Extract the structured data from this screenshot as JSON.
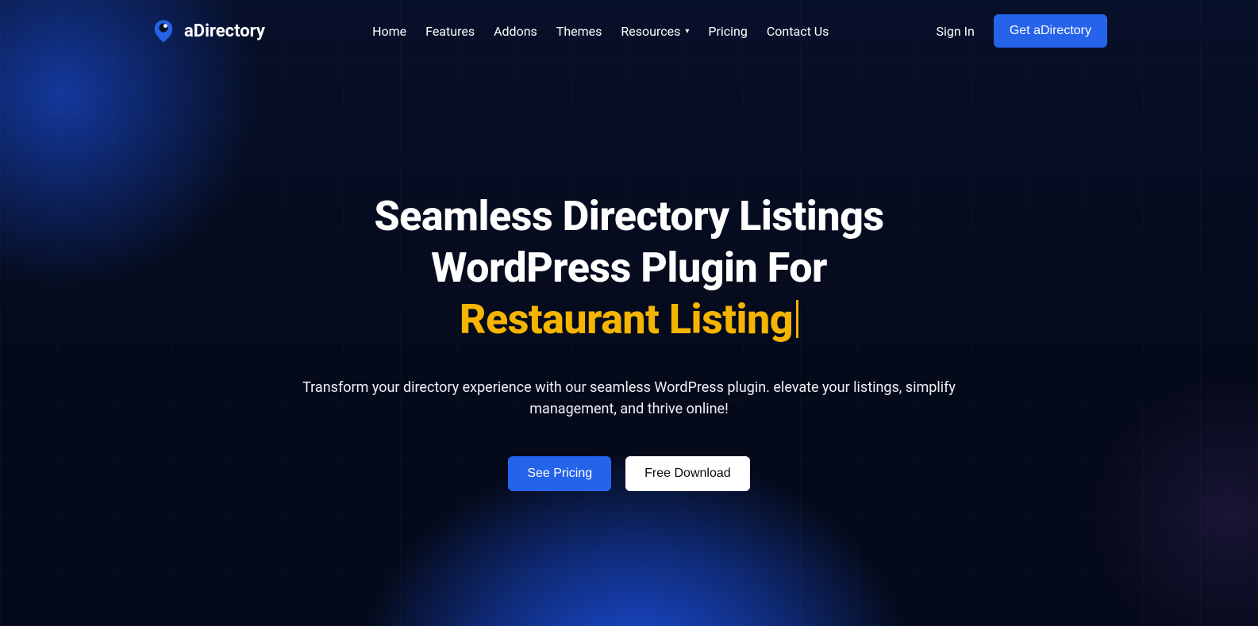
{
  "brand": {
    "name": "aDirectory"
  },
  "nav": {
    "items": [
      {
        "label": "Home"
      },
      {
        "label": "Features"
      },
      {
        "label": "Addons"
      },
      {
        "label": "Themes"
      },
      {
        "label": "Resources",
        "has_dropdown": true
      },
      {
        "label": "Pricing"
      },
      {
        "label": "Contact Us"
      }
    ],
    "sign_in": "Sign In",
    "cta": "Get aDirectory"
  },
  "hero": {
    "title_line1": "Seamless Directory Listings",
    "title_line2": "WordPress Plugin For",
    "title_accent": "Restaurant Listing",
    "subtitle": "Transform your directory experience with our seamless WordPress plugin. elevate your listings, simplify management, and thrive online!",
    "primary_btn": "See Pricing",
    "secondary_btn": "Free Download"
  },
  "colors": {
    "primary": "#2563eb",
    "accent": "#f5b400",
    "bg": "#050a1a"
  }
}
